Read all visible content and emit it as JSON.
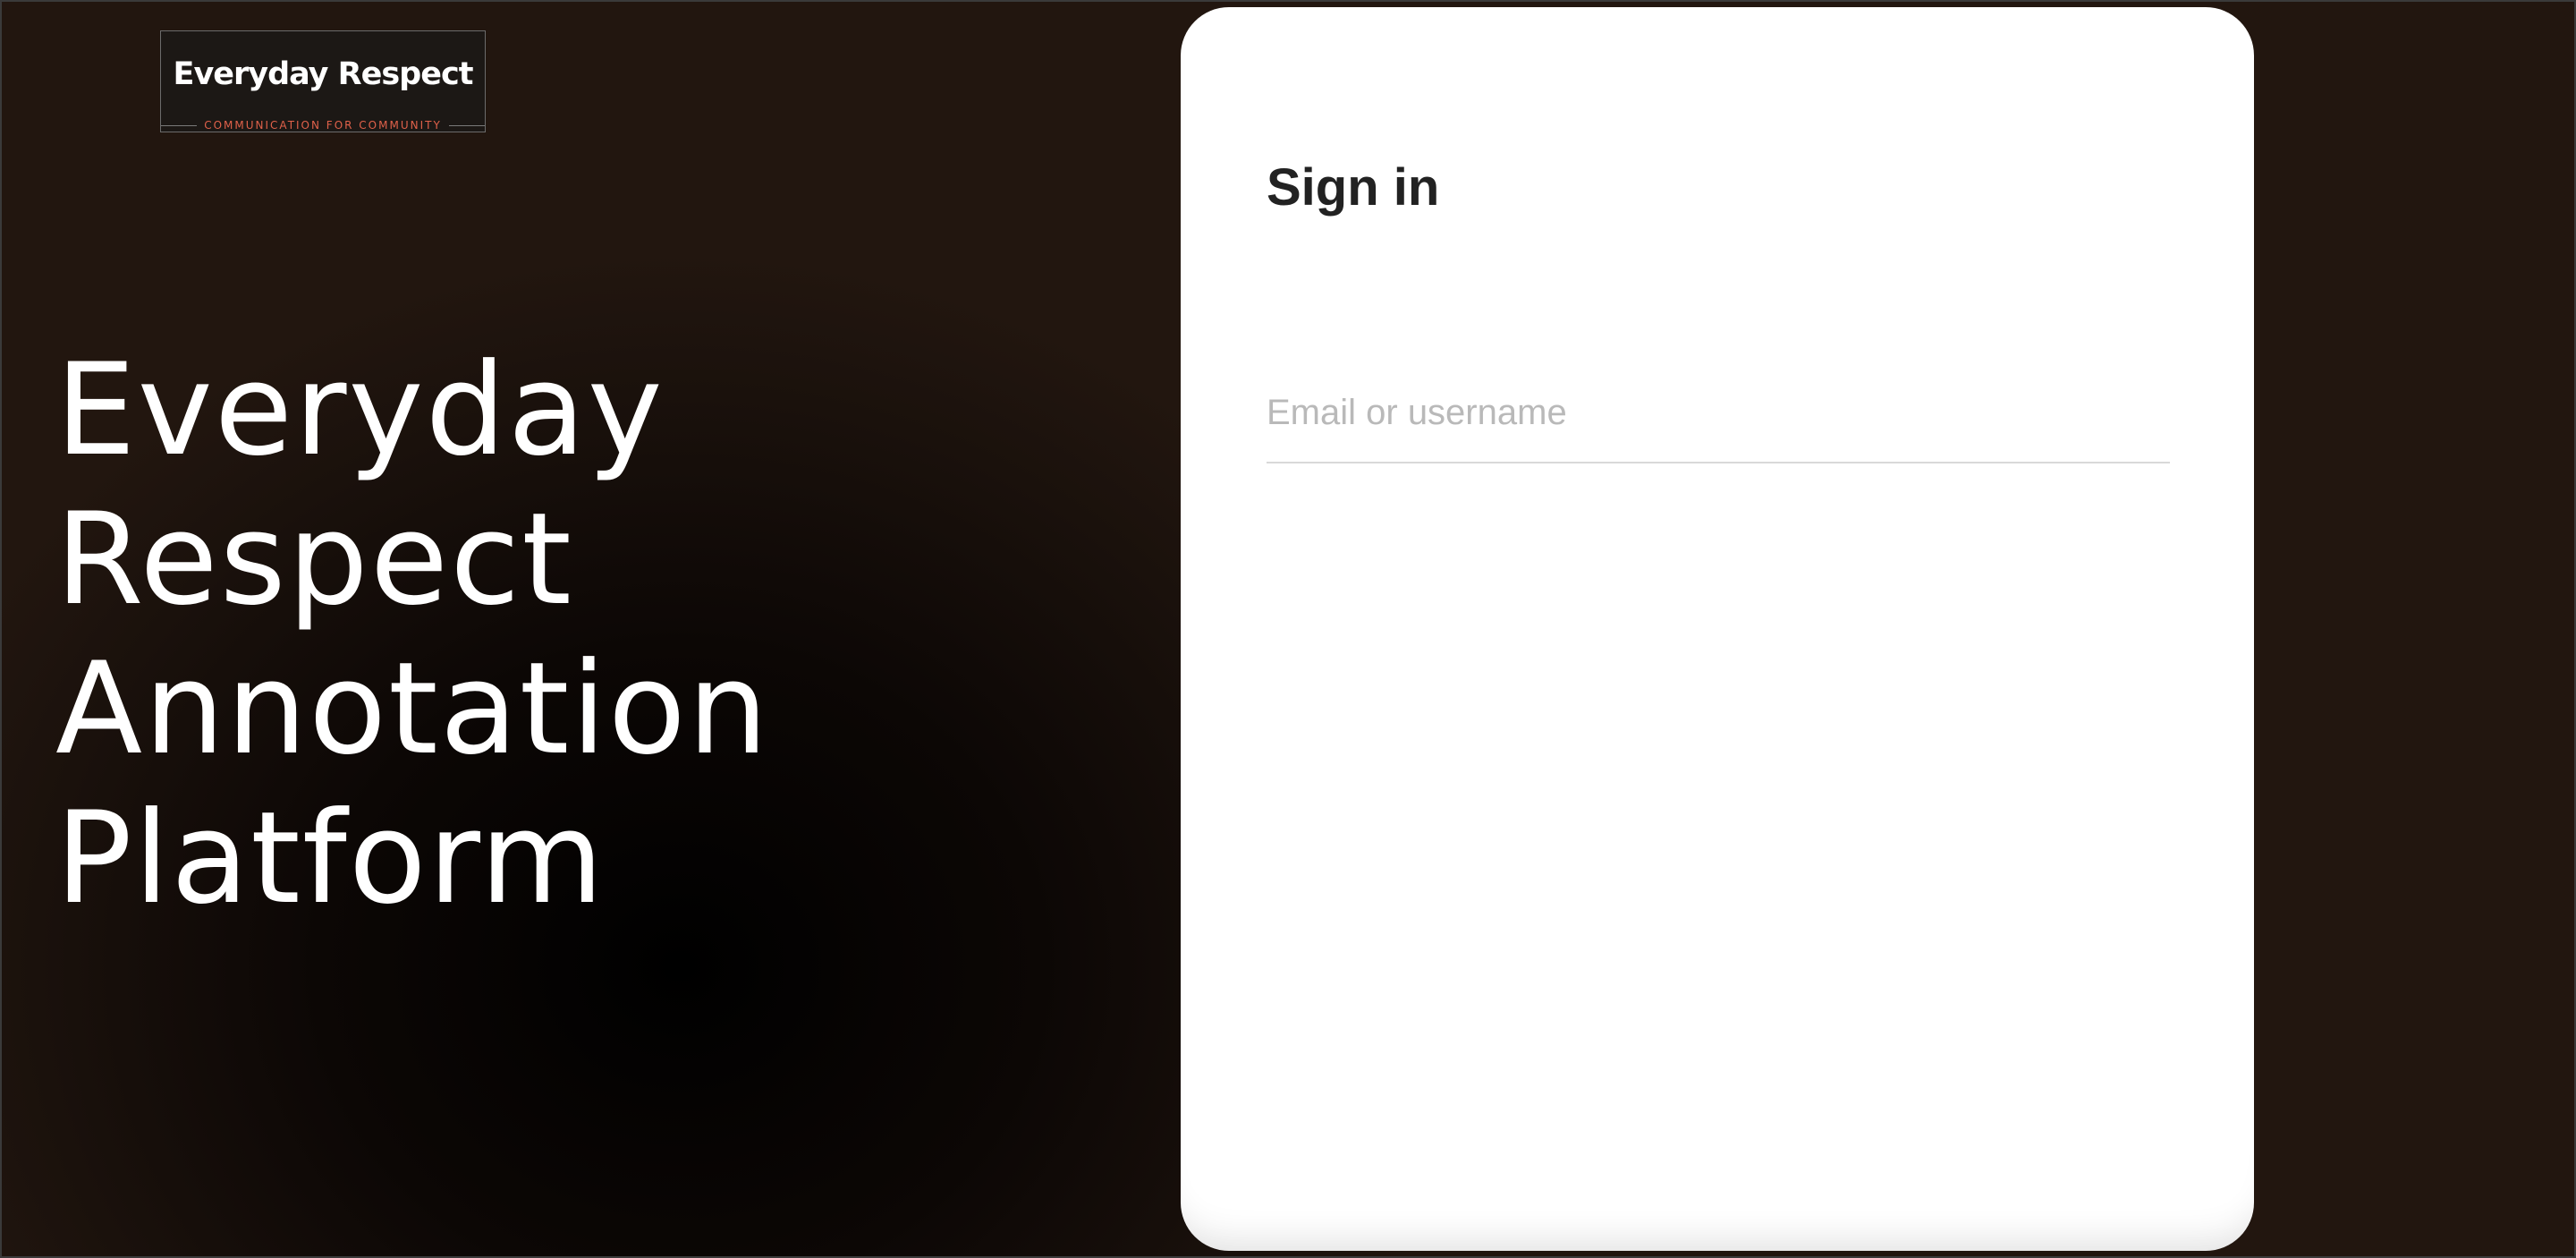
{
  "logo": {
    "title": "Everyday Respect",
    "tagline": "COMMUNICATION FOR COMMUNITY"
  },
  "hero": {
    "lines": [
      "Everyday",
      "Respect",
      "Annotation",
      "Platform"
    ]
  },
  "signin": {
    "title": "Sign in",
    "username_field": {
      "placeholder": "Email or username",
      "value": ""
    }
  },
  "colors": {
    "accent": "#e0614a",
    "background": "#1a110c",
    "card": "#ffffff"
  }
}
